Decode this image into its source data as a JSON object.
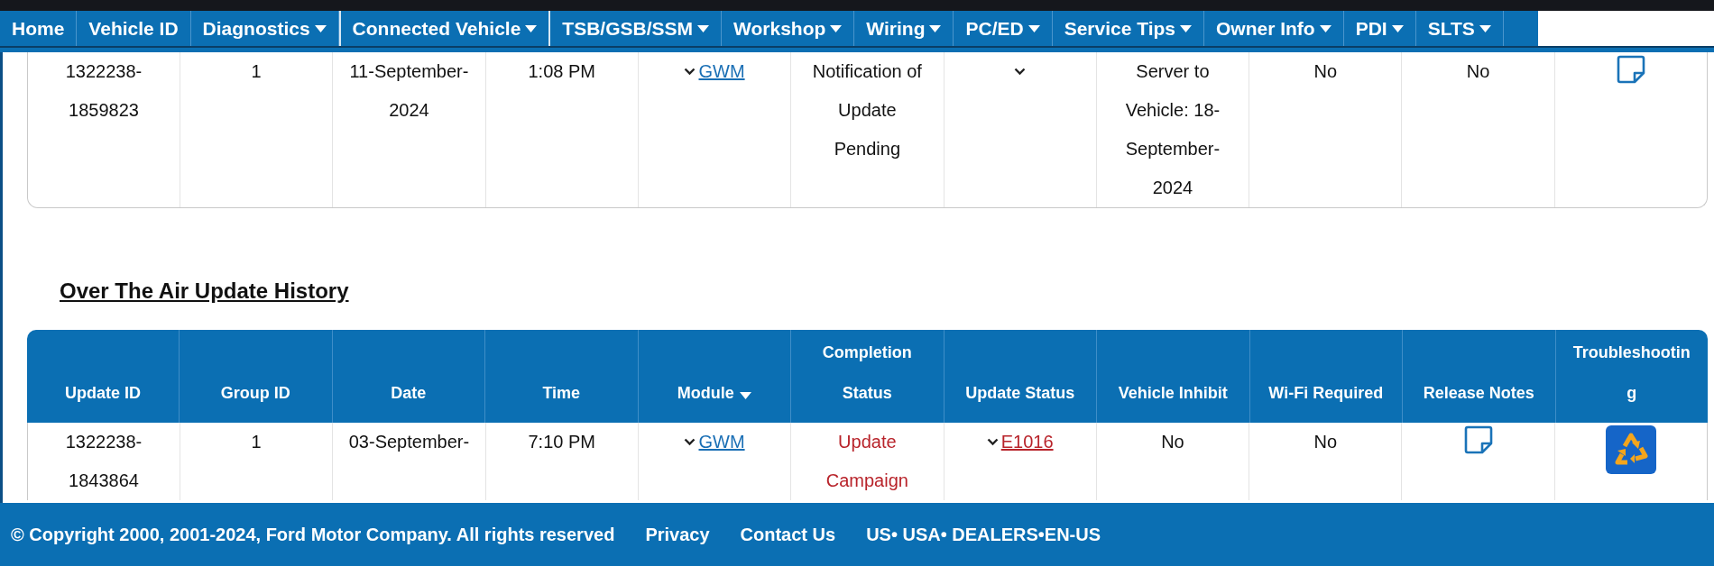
{
  "nav": {
    "items": [
      {
        "label": "Home",
        "menu": false,
        "selected": false
      },
      {
        "label": "Vehicle ID",
        "menu": false,
        "selected": false
      },
      {
        "label": "Diagnostics",
        "menu": true,
        "selected": false
      },
      {
        "label": "Connected Vehicle",
        "menu": true,
        "selected": true
      },
      {
        "label": "TSB/GSB/SSM",
        "menu": true,
        "selected": false
      },
      {
        "label": "Workshop",
        "menu": true,
        "selected": false
      },
      {
        "label": "Wiring",
        "menu": true,
        "selected": false
      },
      {
        "label": "PC/ED",
        "menu": true,
        "selected": false
      },
      {
        "label": "Service Tips",
        "menu": true,
        "selected": false
      },
      {
        "label": "Owner Info",
        "menu": true,
        "selected": false
      },
      {
        "label": "PDI",
        "menu": true,
        "selected": false
      },
      {
        "label": "SLTS",
        "menu": true,
        "selected": false
      }
    ]
  },
  "update_table": {
    "rows": [
      {
        "cells": [
          {
            "kind": "text",
            "text": "1322238-1859823"
          },
          {
            "kind": "text",
            "text": "1"
          },
          {
            "kind": "text",
            "text": "11-September-2024"
          },
          {
            "kind": "text",
            "text": "1:08 PM"
          },
          {
            "kind": "link",
            "text": "GWM"
          },
          {
            "kind": "text",
            "text": "Notification of Update Pending"
          },
          {
            "kind": "chevron"
          },
          {
            "kind": "text",
            "text": "Server to Vehicle: 18-September-2024"
          },
          {
            "kind": "text",
            "text": "No"
          },
          {
            "kind": "text",
            "text": "No"
          },
          {
            "kind": "notes"
          }
        ]
      }
    ]
  },
  "ota_history": {
    "title": "Over The Air Update History",
    "columns": [
      {
        "label": "Update ID",
        "sortable": false
      },
      {
        "label": "Group ID",
        "sortable": false
      },
      {
        "label": "Date",
        "sortable": false
      },
      {
        "label": "Time",
        "sortable": false
      },
      {
        "label": "Module",
        "sortable": true
      },
      {
        "label": "Completion Status",
        "sortable": false
      },
      {
        "label": "Update Status",
        "sortable": false
      },
      {
        "label": "Vehicle Inhibit",
        "sortable": false
      },
      {
        "label": "Wi-Fi Required",
        "sortable": false
      },
      {
        "label": "Release Notes",
        "sortable": false
      },
      {
        "label": "Troubleshooting",
        "sortable": false
      }
    ],
    "rows": [
      {
        "cells": [
          {
            "kind": "text",
            "text": "1322238-1843864"
          },
          {
            "kind": "text",
            "text": "1"
          },
          {
            "kind": "text",
            "text": "03-September-"
          },
          {
            "kind": "text",
            "text": "7:10 PM"
          },
          {
            "kind": "link",
            "text": "GWM"
          },
          {
            "kind": "alert",
            "text": "Update Campaign"
          },
          {
            "kind": "alert-link",
            "text": "E1016"
          },
          {
            "kind": "text",
            "text": "No"
          },
          {
            "kind": "text",
            "text": "No"
          },
          {
            "kind": "notes"
          },
          {
            "kind": "troubleshoot"
          }
        ]
      }
    ]
  },
  "footer": {
    "copyright": "© Copyright 2000, 2001-2024, Ford Motor Company. All rights reserved",
    "links": [
      "Privacy",
      "Contact Us"
    ],
    "locale": "US• USA• DEALERS•EN-US"
  }
}
